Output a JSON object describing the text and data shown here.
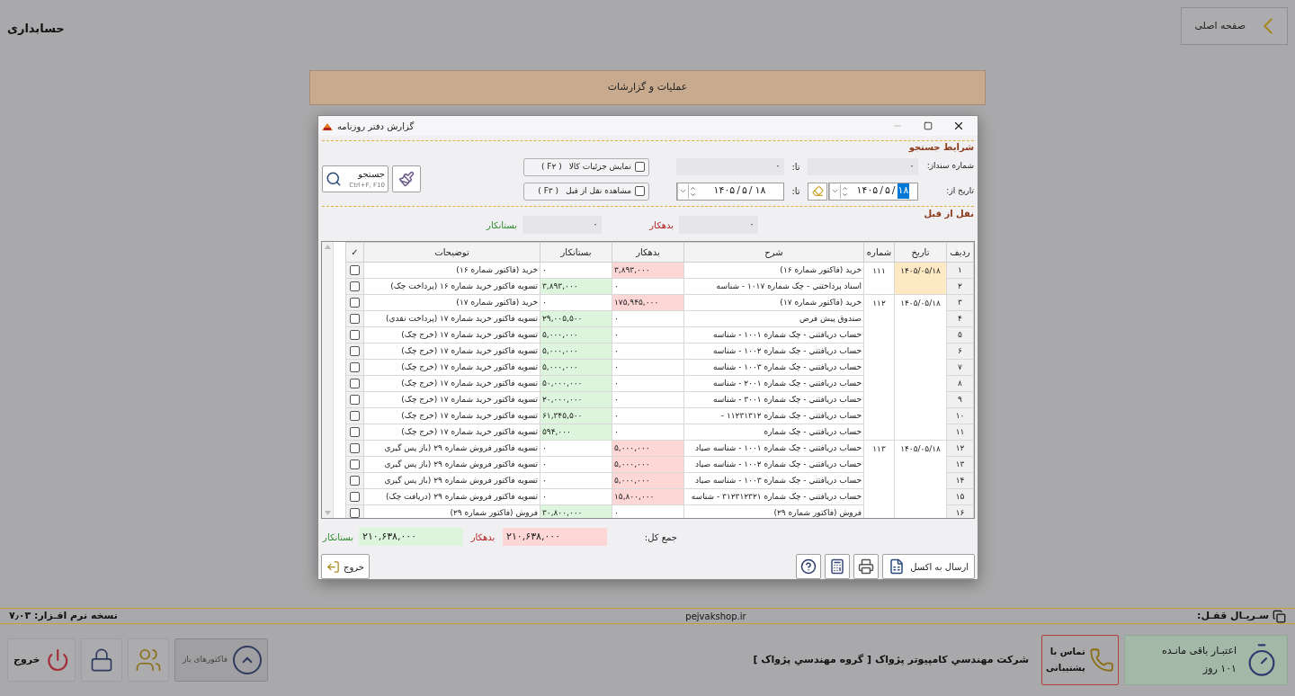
{
  "app": {
    "title": "حسابداری",
    "home_button": "صفحه اصلی",
    "menu_bar": "عملیات و گزارشات"
  },
  "dialog": {
    "title": "گزارش دفتر روزنامه",
    "search_section": {
      "heading": "شرایط جستجو",
      "doc_from_label": "شماره سنداز:",
      "doc_from": "۰",
      "doc_to_label": "تا:",
      "doc_to": "۰",
      "date_from_label": "تاریخ از:",
      "date_from": {
        "year": "۱۴۰۵",
        "month": "۵",
        "day": "۱۸",
        "separator": "/",
        "day_selected": true
      },
      "date_to_label": "تا:",
      "date_to": {
        "year": "۱۴۰۵",
        "month": "۵",
        "day": "۱۸",
        "separator": "/",
        "day_selected": false
      },
      "options": [
        {
          "label": "نمایش جزئیات کالا",
          "shortcut": "( F۲ )",
          "checked": false
        },
        {
          "label": "مشاهده نقل از قبل",
          "shortcut": "( F۳ )",
          "checked": false
        }
      ],
      "search_button": {
        "label": "جستجو",
        "shortcut": "Ctrl+F, F10"
      }
    },
    "carry_over": {
      "heading": "نقل از قبل",
      "debit_label": "بدهکار",
      "debit": "۰",
      "credit_label": "بستانکار",
      "credit": "۰"
    },
    "table": {
      "columns": [
        "ردیف",
        "تاریخ",
        "شماره",
        "شرح",
        "بدهکار",
        "بستانکار",
        "توضیحات",
        "✓"
      ],
      "documents": [
        {
          "date": "۱۴۰۵/۰۵/۱۸",
          "number": "۱۱۱",
          "date_selected": true,
          "rows": [
            {
              "index": "۱",
              "description": "خرید (فاکتور شماره ۱۶)",
              "debit": "۳,۸۹۳,۰۰۰",
              "credit": "۰",
              "notes": "خرید (فاکتور شماره ۱۶)",
              "kind": "debit",
              "checked": false
            },
            {
              "index": "۲",
              "description": "اسناد پرداختني - چک شماره ۱۰۱۷ - شناسه",
              "debit": "۰",
              "credit": "۳,۸۹۳,۰۰۰",
              "notes": "تسویه فاکتور خرید شماره ۱۶ (پرداخت چک)",
              "kind": "credit",
              "checked": false
            }
          ]
        },
        {
          "date": "۱۴۰۵/۰۵/۱۸",
          "number": "۱۱۲",
          "date_selected": false,
          "rows": [
            {
              "index": "۳",
              "description": "خرید (فاکتور شماره ۱۷)",
              "debit": "۱۷۵,۹۴۵,۰۰۰",
              "credit": "۰",
              "notes": "خرید (فاکتور شماره ۱۷)",
              "kind": "debit",
              "checked": false
            },
            {
              "index": "۴",
              "description": "صندوق پیش فرض",
              "debit": "۰",
              "credit": "۲۹,۰۰۵,۵۰۰",
              "notes": "تسویه فاکتور خرید شماره ۱۷ (پرداخت نقدي)",
              "kind": "credit",
              "checked": false
            },
            {
              "index": "۵",
              "description": "حساب دریافتني - چک شماره ۱۰۰۱ - شناسه",
              "debit": "۰",
              "credit": "۵,۰۰۰,۰۰۰",
              "notes": "تسویه فاکتور خرید شماره ۱۷ (خرج چک)",
              "kind": "credit",
              "checked": false
            },
            {
              "index": "۶",
              "description": "حساب دریافتني - چک شماره ۱۰۰۲ - شناسه",
              "debit": "۰",
              "credit": "۵,۰۰۰,۰۰۰",
              "notes": "تسویه فاکتور خرید شماره ۱۷ (خرج چک)",
              "kind": "credit",
              "checked": false
            },
            {
              "index": "۷",
              "description": "حساب دریافتني - چک شماره ۱۰۰۳ - شناسه",
              "debit": "۰",
              "credit": "۵,۰۰۰,۰۰۰",
              "notes": "تسویه فاکتور خرید شماره ۱۷ (خرج چک)",
              "kind": "credit",
              "checked": false
            },
            {
              "index": "۸",
              "description": "حساب دریافتني - چک شماره ۲۰۰۱ - شناسه",
              "debit": "۰",
              "credit": "۵۰,۰۰۰,۰۰۰",
              "notes": "تسویه فاکتور خرید شماره ۱۷ (خرج چک)",
              "kind": "credit",
              "checked": false
            },
            {
              "index": "۹",
              "description": "حساب دریافتني - چک شماره ۳۰۰۱ - شناسه",
              "debit": "۰",
              "credit": "۲۰,۰۰۰,۰۰۰",
              "notes": "تسویه فاکتور خرید شماره ۱۷ (خرج چک)",
              "kind": "credit",
              "checked": false
            },
            {
              "index": "۱۰",
              "description": "حساب دریافتني - چک شماره ۱۱۲۳۱۳۱۲ -",
              "debit": "۰",
              "credit": "۶۱,۳۴۵,۵۰۰",
              "notes": "تسویه فاکتور خرید شماره ۱۷ (خرج چک)",
              "kind": "credit",
              "checked": false
            },
            {
              "index": "۱۱",
              "description": "حساب دریافتني - چک شماره",
              "debit": "۰",
              "credit": "۵۹۴,۰۰۰",
              "notes": "تسویه فاکتور خرید شماره ۱۷ (خرج چک)",
              "kind": "credit",
              "checked": false
            }
          ]
        },
        {
          "date": "۱۴۰۵/۰۵/۱۸",
          "number": "۱۱۳",
          "date_selected": false,
          "rows": [
            {
              "index": "۱۲",
              "description": "حساب دریافتني - چک شماره ۱۰۰۱ - شناسه صیاد",
              "debit": "۵,۰۰۰,۰۰۰",
              "credit": "۰",
              "notes": "تسویه فاکتور فروش شماره ۲۹ (باز پس گیري",
              "kind": "debit",
              "checked": false
            },
            {
              "index": "۱۳",
              "description": "حساب دریافتني - چک شماره ۱۰۰۲ - شناسه صیاد",
              "debit": "۵,۰۰۰,۰۰۰",
              "credit": "۰",
              "notes": "تسویه فاکتور فروش شماره ۲۹ (باز پس گیري",
              "kind": "debit",
              "checked": false
            },
            {
              "index": "۱۴",
              "description": "حساب دریافتني - چک شماره ۱۰۰۳ - شناسه صیاد",
              "debit": "۵,۰۰۰,۰۰۰",
              "credit": "۰",
              "notes": "تسویه فاکتور فروش شماره ۲۹ (باز پس گیري",
              "kind": "debit",
              "checked": false
            },
            {
              "index": "۱۵",
              "description": "حساب دریافتني - چک شماره ۳۱۲۳۱۲۳۲۱ - شناسه",
              "debit": "۱۵,۸۰۰,۰۰۰",
              "credit": "۰",
              "notes": "تسویه فاکتور فروش شماره ۲۹ (دریافت چک)",
              "kind": "debit",
              "checked": false
            },
            {
              "index": "۱۶",
              "description": "فروش (فاکتور شماره ۲۹)",
              "debit": "۰",
              "credit": "۳۰,۸۰۰,۰۰۰",
              "notes": "فروش (فاکتور شماره ۲۹)",
              "kind": "credit",
              "checked": false
            }
          ]
        }
      ]
    },
    "totals": {
      "label": "جمع کل:",
      "debit": "۲۱۰,۶۳۸,۰۰۰",
      "debit_label": "بدهکار",
      "credit": "۲۱۰,۶۳۸,۰۰۰",
      "credit_label": "بستانکار"
    },
    "buttons": {
      "excel": "ارسال به اکسل",
      "exit": "خروج"
    }
  },
  "status_bar": {
    "version": "نسخه نرم افـزار: ۷٫۰۳",
    "website": "pejvakshop.ir",
    "serial_label": "سـریـال قفـل:"
  },
  "bottom_bar": {
    "credit_title": "اعتبـار باقی مانـده",
    "credit_days": "۱۰۱ روز",
    "support": "تماس با پشتیبانی",
    "company": "شرکت مهندسي کامپیوتر پژواک [ گروه مهندسي پژواک ]",
    "open_invoices": "فاکتورهای باز",
    "exit": "خروج"
  }
}
